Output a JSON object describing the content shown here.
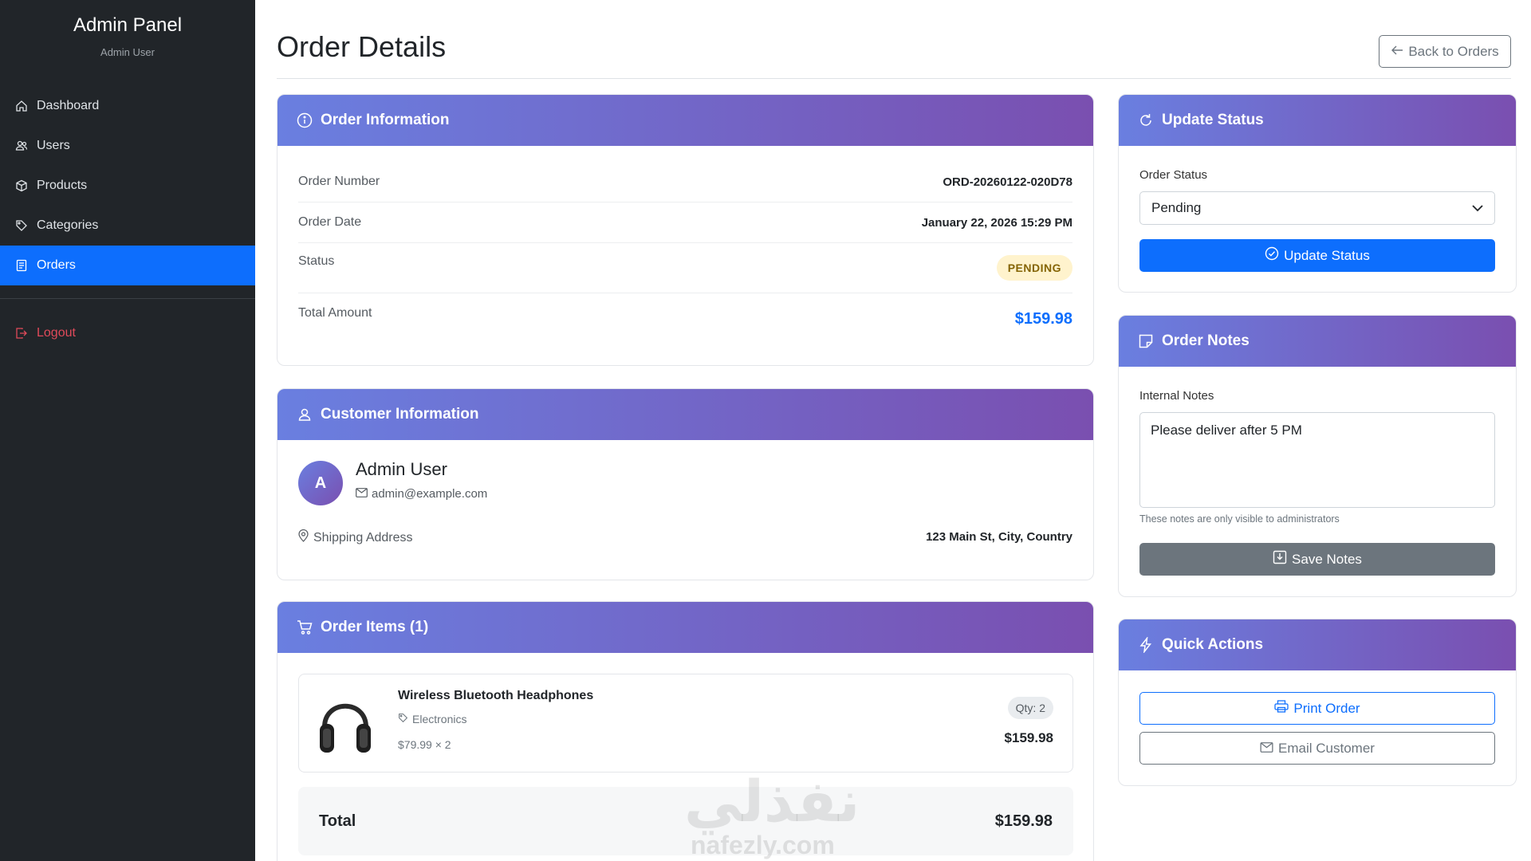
{
  "sidebar": {
    "title": "Admin Panel",
    "subtitle": "Admin User",
    "items": [
      {
        "label": "Dashboard",
        "icon": "home-icon"
      },
      {
        "label": "Users",
        "icon": "users-icon"
      },
      {
        "label": "Products",
        "icon": "box-icon"
      },
      {
        "label": "Categories",
        "icon": "tags-icon"
      },
      {
        "label": "Orders",
        "icon": "receipt-icon",
        "active": true
      }
    ],
    "logout": "Logout"
  },
  "header": {
    "title": "Order Details",
    "back_label": "Back to Orders"
  },
  "order_info": {
    "title": "Order Information",
    "number_label": "Order Number",
    "number": "ORD-20260122-020D78",
    "date_label": "Order Date",
    "date": "January 22, 2026 15:29 PM",
    "status_label": "Status",
    "status": "PENDING",
    "total_label": "Total Amount",
    "total": "$159.98"
  },
  "customer": {
    "title": "Customer Information",
    "initial": "A",
    "name": "Admin User",
    "email": "admin@example.com",
    "shipping_label": "Shipping Address",
    "shipping": "123 Main St, City, Country"
  },
  "items": {
    "title": "Order Items (1)",
    "list": [
      {
        "name": "Wireless Bluetooth Headphones",
        "category": "Electronics",
        "unit": "$79.99 × 2",
        "qty": "Qty: 2",
        "subtotal": "$159.98"
      }
    ],
    "total_label": "Total",
    "total": "$159.98"
  },
  "update_status": {
    "title": "Update Status",
    "label": "Order Status",
    "selected": "Pending",
    "button": "Update Status"
  },
  "notes": {
    "title": "Order Notes",
    "label": "Internal Notes",
    "value": "Please deliver after 5 PM",
    "help": "These notes are only visible to administrators",
    "button": "Save Notes"
  },
  "quick_actions": {
    "title": "Quick Actions",
    "print": "Print Order",
    "email": "Email Customer"
  },
  "watermark": {
    "text": "نفذلي",
    "sub": "nafezly.com"
  },
  "colors": {
    "primary": "#0d6efd",
    "sidebar": "#212529",
    "header_gradient_start": "#6a7fe0",
    "header_gradient_end": "#7a4fb0",
    "danger": "#e04a5a"
  }
}
